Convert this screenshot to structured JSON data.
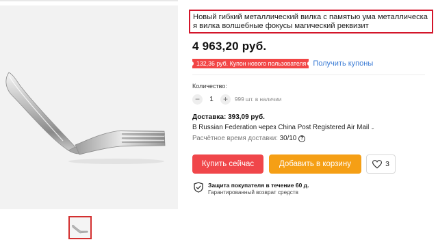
{
  "product": {
    "title": "Новый гибкий металлический вилка с памятью ума металлическая вилка волшебные фокусы магический реквизит",
    "price": "4 963,20 руб.",
    "image_alt_icon": "bent-fork-image"
  },
  "coupon": {
    "badge": "132,36 руб. Купон нового пользователя",
    "link": "Получить купоны",
    "badge_color": "#f24545",
    "link_color": "#3a7bd5"
  },
  "quantity": {
    "label": "Количество:",
    "minus": "−",
    "value": "1",
    "plus": "+",
    "stock": "999 шт. в наличии"
  },
  "delivery": {
    "title": "Доставка: 393,09 руб.",
    "route": "В Russian Federation через China Post Registered Air Mail",
    "route_chevron": "⌄",
    "time_label": "Расчётное время доставки:",
    "time_value": "30/10",
    "help_icon": "?"
  },
  "actions": {
    "buy": "Купить сейчас",
    "cart": "Добавить в корзину",
    "wishlist_count": "3",
    "buy_color": "#f0464a",
    "cart_color": "#f59f15"
  },
  "protection": {
    "title": "Защита покупателя в течение 60 д.",
    "subtitle": "Гарантированный возврат средств"
  }
}
